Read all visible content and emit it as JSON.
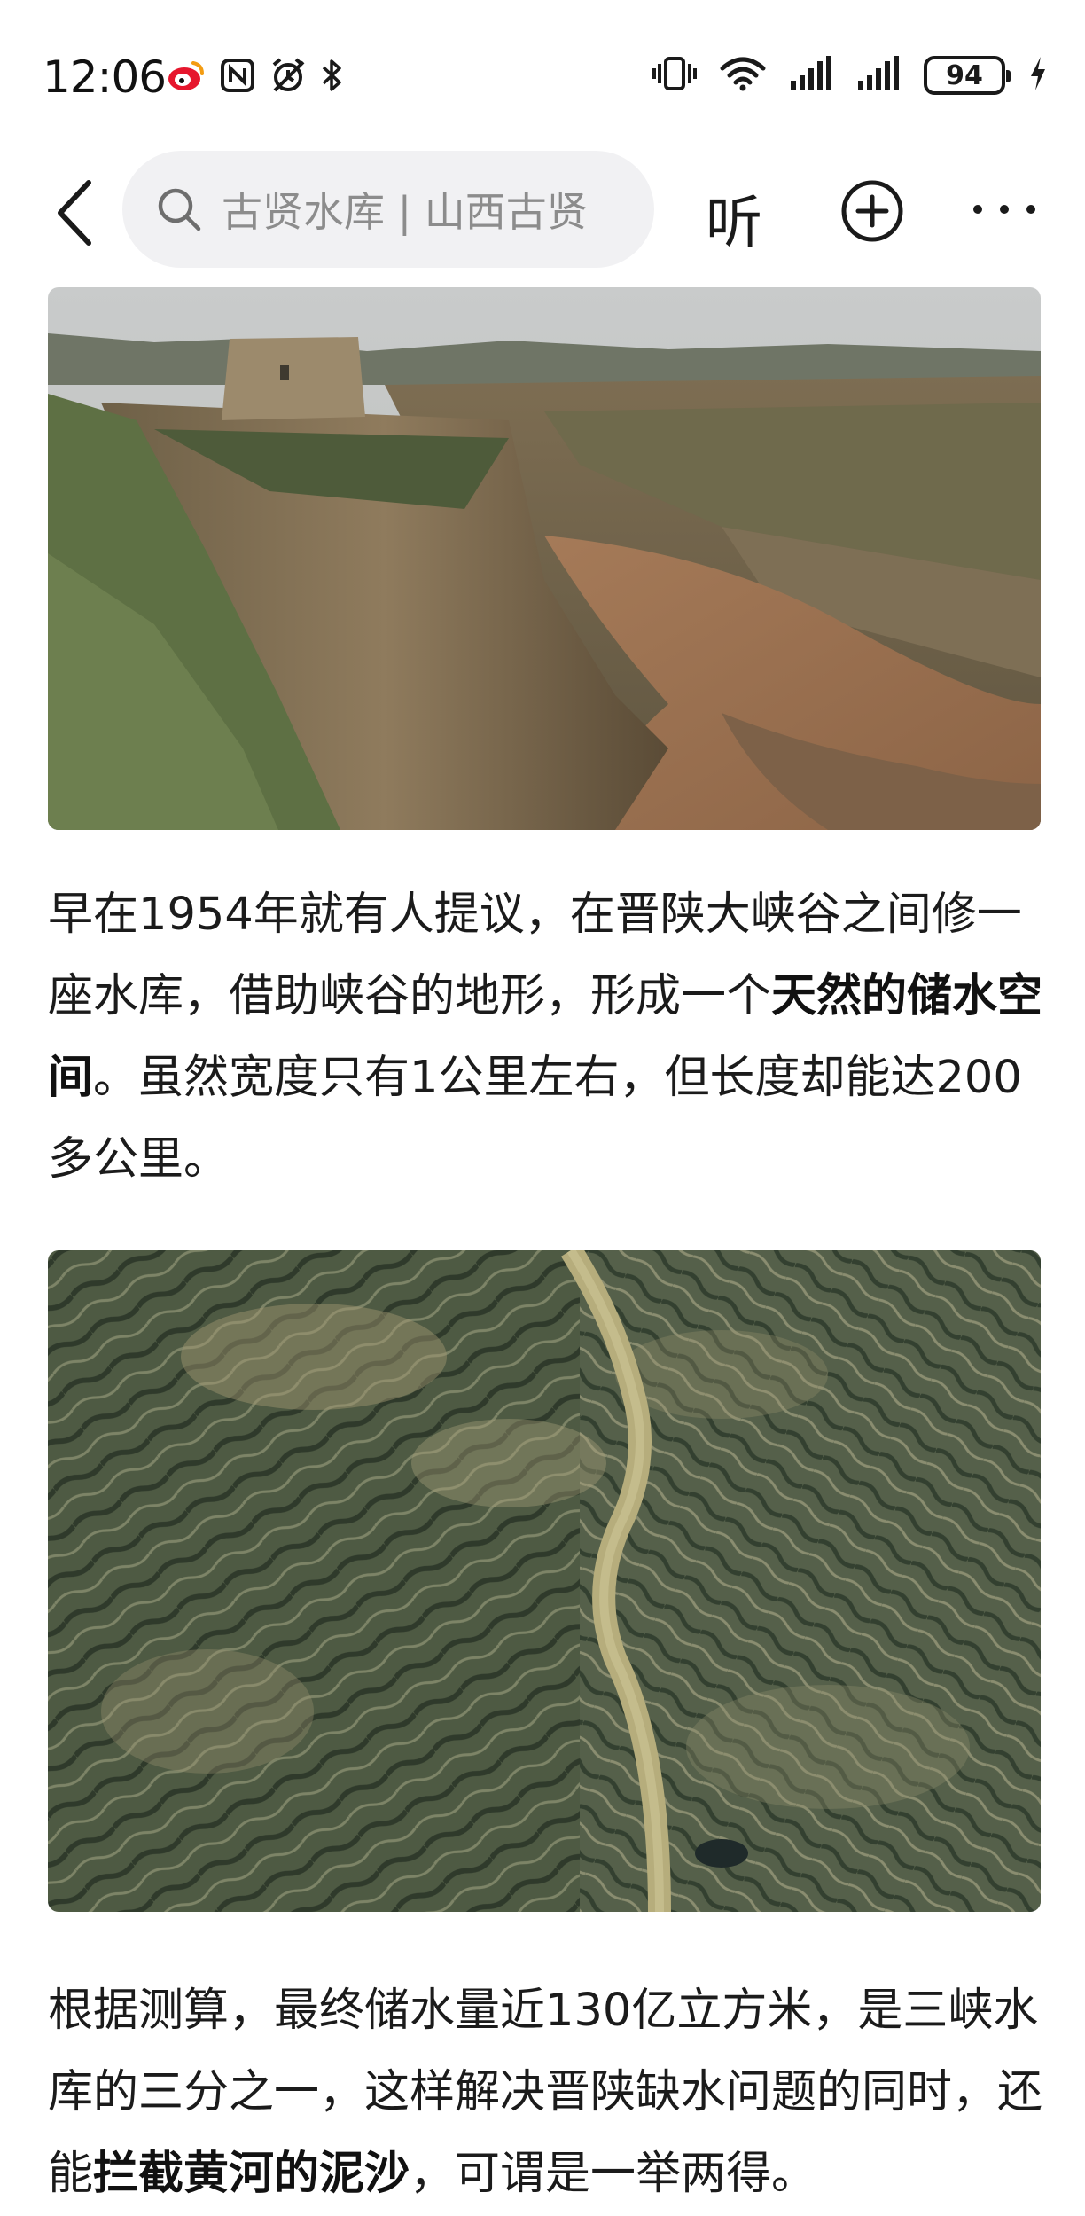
{
  "status_bar": {
    "time": "12:06",
    "battery": "94",
    "left_icons": [
      "weibo-icon",
      "nfc-icon",
      "alarm-icon",
      "bluetooth-icon"
    ],
    "right_icons": [
      "vibrate-icon",
      "wifi-icon",
      "signal-icon",
      "signal-icon",
      "battery-icon",
      "charging-icon"
    ]
  },
  "nav": {
    "search_text": "古贤水库 | 山西古贤",
    "listen_label": "听",
    "icons": [
      "back-icon",
      "search-icon",
      "plus-circle-icon",
      "more-icon"
    ]
  },
  "article": {
    "para1": {
      "text_a": "早在1954年就有人提议，在晋陕大峡谷之间修一座水库，借助峡谷的地形，形成一个",
      "bold": "天然的储水空间",
      "text_b": "。虽然宽度只有1公里左右，但长度却能达200多公里。"
    },
    "para2": {
      "text_a": "根据测算，最终储水量近130亿立方米，是三峡水库的三分之一，这样解决晋陕缺水问题的同时，还能",
      "bold": "拦截黄河的泥沙",
      "text_b": "，可谓是一举两得。"
    }
  },
  "colors": {
    "search_bg": "#f1f1f3",
    "placeholder": "#8c8c8c",
    "text": "#1b1b1b"
  }
}
